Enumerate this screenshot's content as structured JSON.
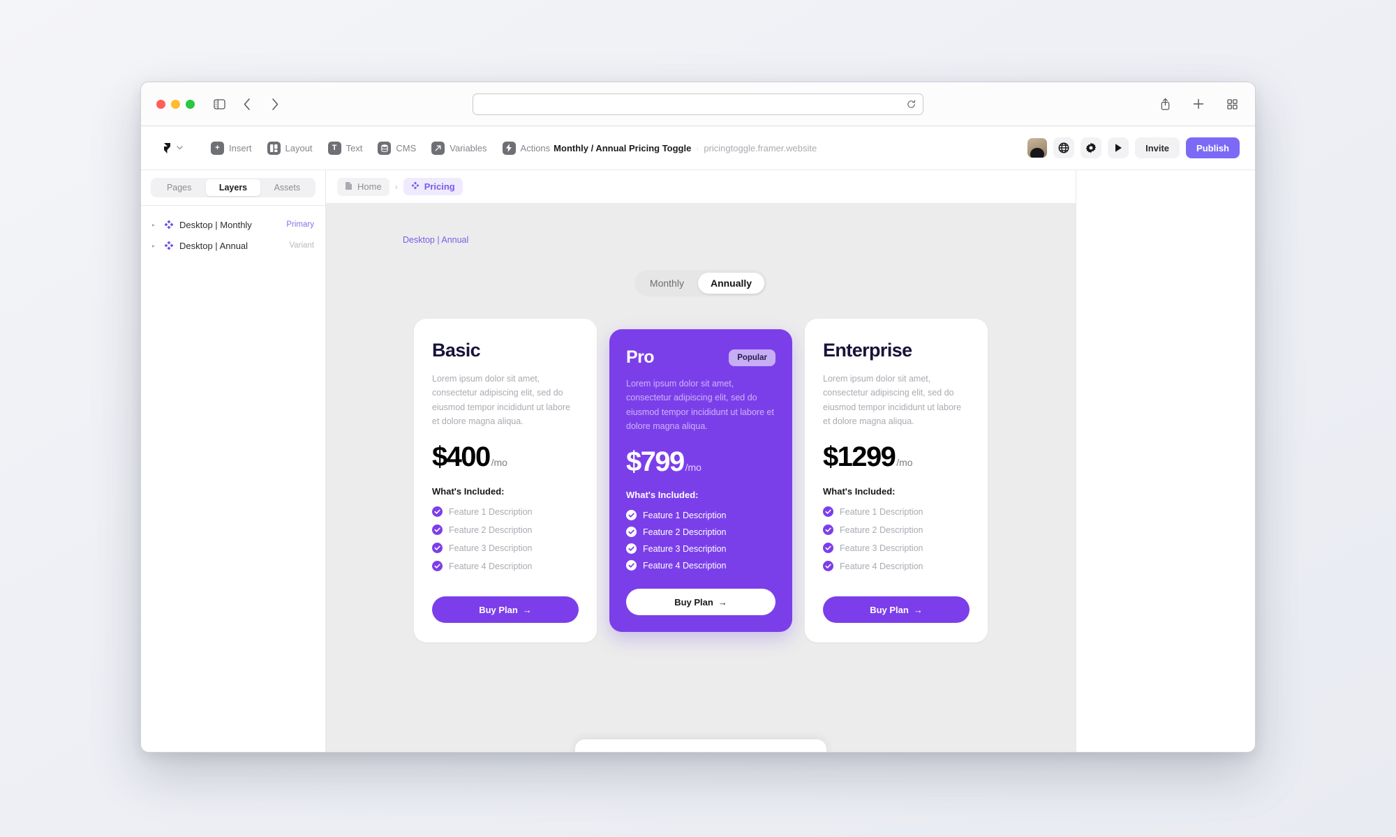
{
  "browser": {
    "traffic_lights": [
      "close",
      "minimize",
      "maximize"
    ],
    "sidebar_toggle_icon": "sidebar-icon",
    "back_icon": "chevron-left-icon",
    "forward_icon": "chevron-right-icon",
    "url_value": "",
    "url_placeholder": "",
    "reload_icon": "reload-icon",
    "share_icon": "share-icon",
    "new_tab_icon": "plus-icon",
    "tab_overview_icon": "grid-icon"
  },
  "toolbar": {
    "logo_icon": "framer-logo-icon",
    "chevron_icon": "chevron-down-icon",
    "tools": [
      {
        "label": "Insert",
        "icon": "plus-icon"
      },
      {
        "label": "Layout",
        "icon": "layout-icon"
      },
      {
        "label": "Text",
        "icon": "text-icon"
      },
      {
        "label": "CMS",
        "icon": "cms-icon"
      },
      {
        "label": "Variables",
        "icon": "variables-icon"
      },
      {
        "label": "Actions",
        "icon": "actions-icon"
      }
    ],
    "doc_name": "Monthly / Annual Pricing Toggle",
    "doc_separator": "·",
    "doc_url": "pricingtoggle.framer.website",
    "avatar_name": "user-avatar",
    "globe_icon": "globe-icon",
    "settings_icon": "gear-icon",
    "preview_icon": "play-icon",
    "invite_label": "Invite",
    "publish_label": "Publish",
    "publish_color": "#7c6af6"
  },
  "sidebar": {
    "tabs": [
      {
        "label": "Pages",
        "active": false
      },
      {
        "label": "Layers",
        "active": true
      },
      {
        "label": "Assets",
        "active": false
      }
    ],
    "layers": [
      {
        "name": "Desktop | Monthly",
        "tag": "Primary",
        "tag_kind": "primary"
      },
      {
        "name": "Desktop | Annual",
        "tag": "Variant",
        "tag_kind": "variant"
      }
    ]
  },
  "breadcrumb": {
    "home_label": "Home",
    "home_icon": "page-icon",
    "separator": "›",
    "current_label": "Pricing",
    "current_icon": "component-icon"
  },
  "canvas": {
    "frame_label": "Desktop | Annual",
    "frame_label_color": "#7c5ce6",
    "toggle": {
      "options": [
        {
          "label": "Monthly",
          "selected": false
        },
        {
          "label": "Annually",
          "selected": true
        }
      ]
    },
    "whats_included_label": "What's Included:",
    "buy_label": "Buy Plan",
    "buy_arrow": "→",
    "accent": "#7c3eea",
    "pro_bg": "#7b3fea",
    "cards": [
      {
        "title": "Basic",
        "featured": false,
        "badge": null,
        "description": "Lorem ipsum dolor sit amet, consectetur adipiscing elit, sed do eiusmod tempor incididunt ut labore et dolore magna aliqua.",
        "price": "$400",
        "period": "/mo",
        "features": [
          "Feature 1 Description",
          "Feature 2 Description",
          "Feature 3 Description",
          "Feature 4 Description"
        ]
      },
      {
        "title": "Pro",
        "featured": true,
        "badge": "Popular",
        "description": "Lorem ipsum dolor sit amet, consectetur adipiscing elit, sed do eiusmod tempor incididunt ut labore et dolore magna aliqua.",
        "price": "$799",
        "period": "/mo",
        "features": [
          "Feature 1 Description",
          "Feature 2 Description",
          "Feature 3 Description",
          "Feature 4 Description"
        ]
      },
      {
        "title": "Enterprise",
        "featured": false,
        "badge": null,
        "description": "Lorem ipsum dolor sit amet, consectetur adipiscing elit, sed do eiusmod tempor incididunt ut labore et dolore magna aliqua.",
        "price": "$1299",
        "period": "/mo",
        "features": [
          "Feature 1 Description",
          "Feature 2 Description",
          "Feature 3 Description",
          "Feature 4 Description"
        ]
      }
    ]
  }
}
